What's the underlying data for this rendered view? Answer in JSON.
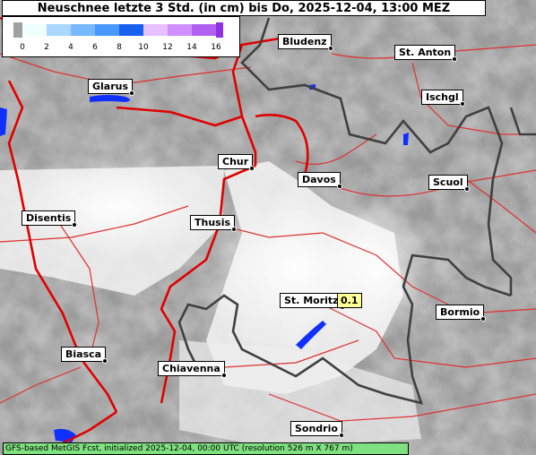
{
  "title": "Neuschnee letzte 3 Std. (in cm) bis Do, 2025-12-04, 13:00 MEZ",
  "legend": {
    "ticks": [
      "0",
      "2",
      "4",
      "6",
      "8",
      "10",
      "12",
      "14",
      "16"
    ],
    "colors": [
      "#f0ffff",
      "#a8d8ff",
      "#78b8ff",
      "#4898ff",
      "#1860f0",
      "#e8c0ff",
      "#d090ff",
      "#b060f0",
      "#9030e0"
    ],
    "nodata_color": "#a0a0a0"
  },
  "footer": "GFS-based MetGIS Fcst, initialized 2025-12-04, 00:00 UTC  (resolution 526 m X 767 m)",
  "places": [
    {
      "name": "Bludenz"
    },
    {
      "name": "St. Anton"
    },
    {
      "name": "Glarus"
    },
    {
      "name": "Ischgl"
    },
    {
      "name": "Chur"
    },
    {
      "name": "Davos"
    },
    {
      "name": "Scuol"
    },
    {
      "name": "Disentis"
    },
    {
      "name": "Thusis"
    },
    {
      "name": "St. Moritz"
    },
    {
      "name": "Bormio"
    },
    {
      "name": "Biasca"
    },
    {
      "name": "Chiavenna"
    },
    {
      "name": "Sondrio"
    }
  ],
  "value_badge": "0.1",
  "colors": {
    "roads_major": "#e00000",
    "roads_minor": "#e03030",
    "borders": "#404040",
    "water": "#1030ff"
  }
}
